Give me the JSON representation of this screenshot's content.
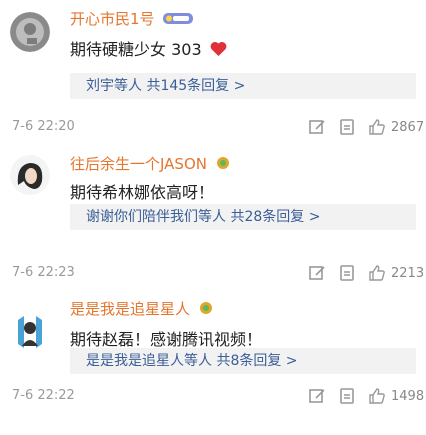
{
  "comments": [
    {
      "username": "开心市民1号",
      "badge": "vip",
      "content": "期待硬糖少女 303",
      "replies_link": "刘宇等人 共145条回复 >",
      "time": "7-6 22:20",
      "likes": "2867"
    },
    {
      "username": "往后余生一个JASON",
      "badge": "fan",
      "content": "期待希林娜依高呀！",
      "replies_link": "谢谢你们陪伴我们等人 共28条回复 >",
      "time": "7-6 22:23",
      "likes": "2213"
    },
    {
      "username": "是是我是追星星人",
      "badge": "fan",
      "content": "期待赵磊！感谢腾讯视频！",
      "replies_link": "是是我是追星人等人 共8条回复 >",
      "time": "7-6 22:22",
      "likes": "1498"
    }
  ],
  "colors": {
    "username": "#e6762e",
    "replies_bg": "#f2f2f2",
    "replies_text": "#3a5e97",
    "heart": "#e0303a"
  }
}
